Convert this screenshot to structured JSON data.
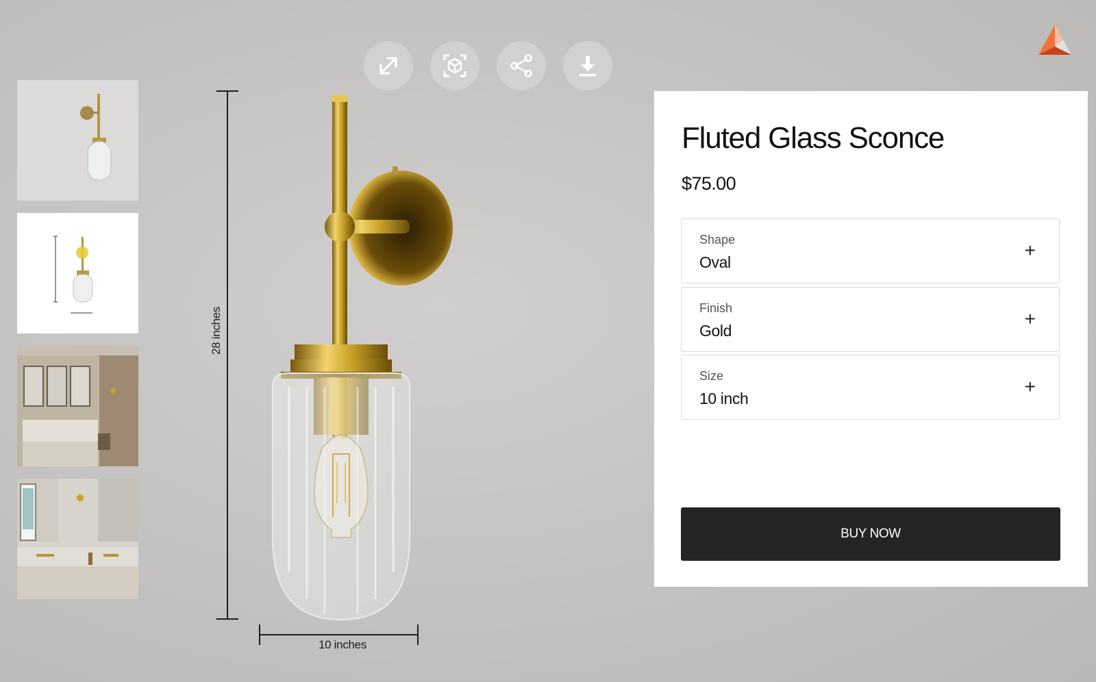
{
  "toolbar": {
    "icons": [
      "expand-icon",
      "ar-view-icon",
      "share-icon",
      "download-icon"
    ]
  },
  "thumbnails": {
    "items": [
      "sconce-front-view",
      "sconce-dimension-view",
      "bedroom-scene",
      "bathroom-scene"
    ],
    "selected_index": 1
  },
  "dimensions": {
    "height_label": "28 inches",
    "width_label": "10 inches"
  },
  "product": {
    "title": "Fluted Glass Sconce",
    "price": "$75.00",
    "options": [
      {
        "label": "Shape",
        "value": "Oval"
      },
      {
        "label": "Finish",
        "value": "Gold"
      },
      {
        "label": "Size",
        "value": "10 inch"
      }
    ],
    "expand_symbol": "+",
    "buy_label": "BUY NOW"
  },
  "colors": {
    "background": "#c5c4c2",
    "panel": "#ffffff",
    "button": "#242424",
    "gold": "#c9a227",
    "brand": "#e8531f"
  }
}
